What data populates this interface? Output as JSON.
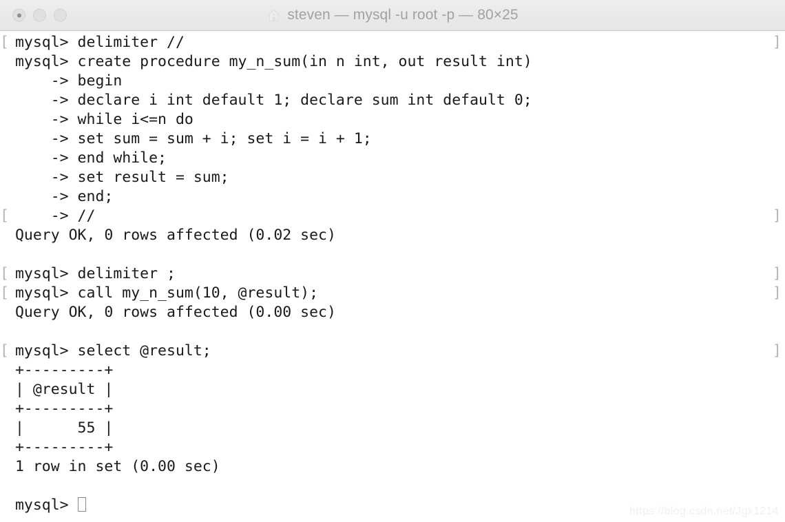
{
  "window": {
    "title": "steven — mysql -u root -p — 80×25",
    "home_icon": "house-icon",
    "traffic_lights": [
      {
        "name": "close",
        "label": "Close"
      },
      {
        "name": "minimize",
        "label": "Minimize"
      },
      {
        "name": "zoom",
        "label": "Zoom"
      }
    ]
  },
  "terminal": {
    "prompt": "mysql>",
    "continuation": "->",
    "cursor": "block-cursor",
    "mark_left": "[",
    "mark_right": "]",
    "lines": [
      {
        "text": " mysql> delimiter //",
        "mark": true
      },
      {
        "text": " mysql> create procedure my_n_sum(in n int, out result int)",
        "mark": false
      },
      {
        "text": "     -> begin",
        "mark": false
      },
      {
        "text": "     -> declare i int default 1; declare sum int default 0;",
        "mark": false
      },
      {
        "text": "     -> while i<=n do",
        "mark": false
      },
      {
        "text": "     -> set sum = sum + i; set i = i + 1;",
        "mark": false
      },
      {
        "text": "     -> end while;",
        "mark": false
      },
      {
        "text": "     -> set result = sum;",
        "mark": false
      },
      {
        "text": "     -> end;",
        "mark": false
      },
      {
        "text": "     -> //",
        "mark": true
      },
      {
        "text": " Query OK, 0 rows affected (0.02 sec)",
        "mark": false
      },
      {
        "text": "",
        "mark": false
      },
      {
        "text": " mysql> delimiter ;",
        "mark": true
      },
      {
        "text": " mysql> call my_n_sum(10, @result);",
        "mark": true
      },
      {
        "text": " Query OK, 0 rows affected (0.00 sec)",
        "mark": false
      },
      {
        "text": "",
        "mark": false
      },
      {
        "text": " mysql> select @result;",
        "mark": true
      },
      {
        "text": " +---------+",
        "mark": false
      },
      {
        "text": " | @result |",
        "mark": false
      },
      {
        "text": " +---------+",
        "mark": false
      },
      {
        "text": " |      55 |",
        "mark": false
      },
      {
        "text": " +---------+",
        "mark": false
      },
      {
        "text": " 1 row in set (0.00 sec)",
        "mark": false
      },
      {
        "text": "",
        "mark": false
      },
      {
        "text": " mysql> ",
        "mark": false,
        "cursor": true
      }
    ]
  },
  "watermark": {
    "text": "https://blog.csdn.net/Jgx1214"
  },
  "colors": {
    "background": "#ffffff",
    "text": "#1a1a1a",
    "titlebar": "#ebebeb",
    "title_text": "#a2a2a2",
    "mark": "#b5b5b5",
    "watermark": "#f0f0f0"
  }
}
